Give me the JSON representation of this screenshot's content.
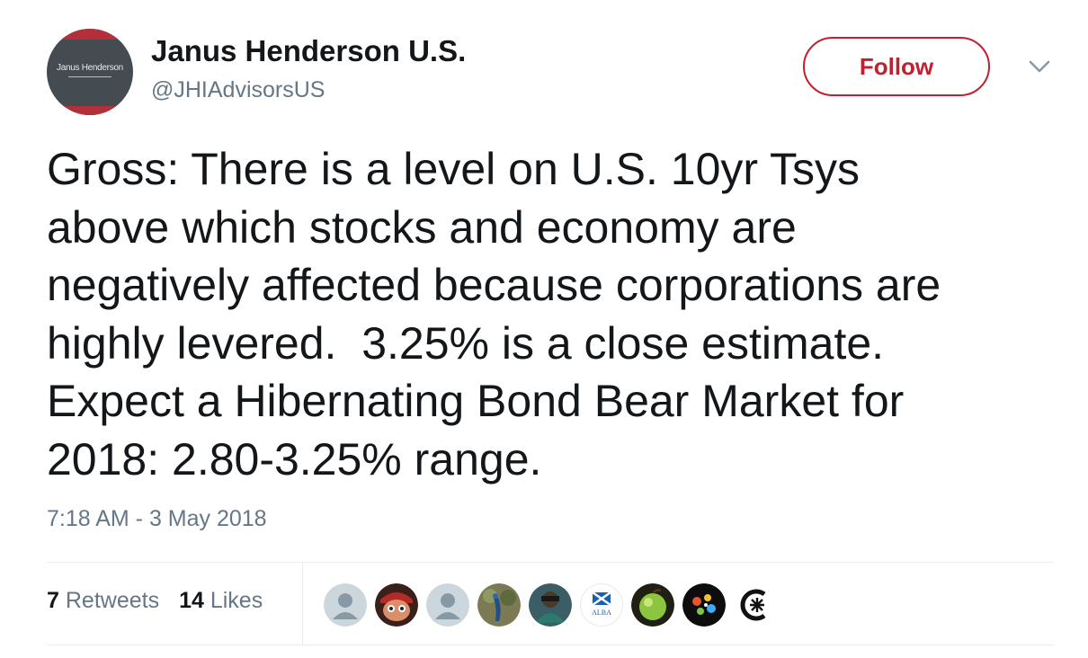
{
  "author": {
    "name": "Janus Henderson U.S.",
    "handle": "@JHIAdvisorsUS",
    "avatar_text": "Janus Henderson"
  },
  "follow_label": "Follow",
  "tweet": {
    "text": "Gross: There is a level on U.S. 10yr Tsys\nabove which stocks and economy are\nnegatively affected because corporations are\nhighly levered.  3.25% is a close estimate.\nExpect a Hibernating Bond Bear Market for\n2018: 2.80-3.25% range.",
    "timestamp": "7:18 AM - 3 May 2018"
  },
  "stats": {
    "retweets_count": "7",
    "retweets_label": "Retweets",
    "likes_count": "14",
    "likes_label": "Likes"
  },
  "likers": [
    {
      "icon": "default-avatar-icon"
    },
    {
      "icon": "cartoon-face-avatar-icon"
    },
    {
      "icon": "default-avatar-icon"
    },
    {
      "icon": "peacock-avatar-icon"
    },
    {
      "icon": "person-avatar-icon"
    },
    {
      "icon": "scotland-flag-avatar-icon",
      "text": "ALBA"
    },
    {
      "icon": "green-apple-avatar-icon"
    },
    {
      "icon": "colorful-splash-avatar-icon"
    },
    {
      "icon": "c-star-logo-avatar-icon"
    }
  ],
  "colors": {
    "accent": "#c0202f",
    "muted": "#657786",
    "text": "#14171a"
  }
}
